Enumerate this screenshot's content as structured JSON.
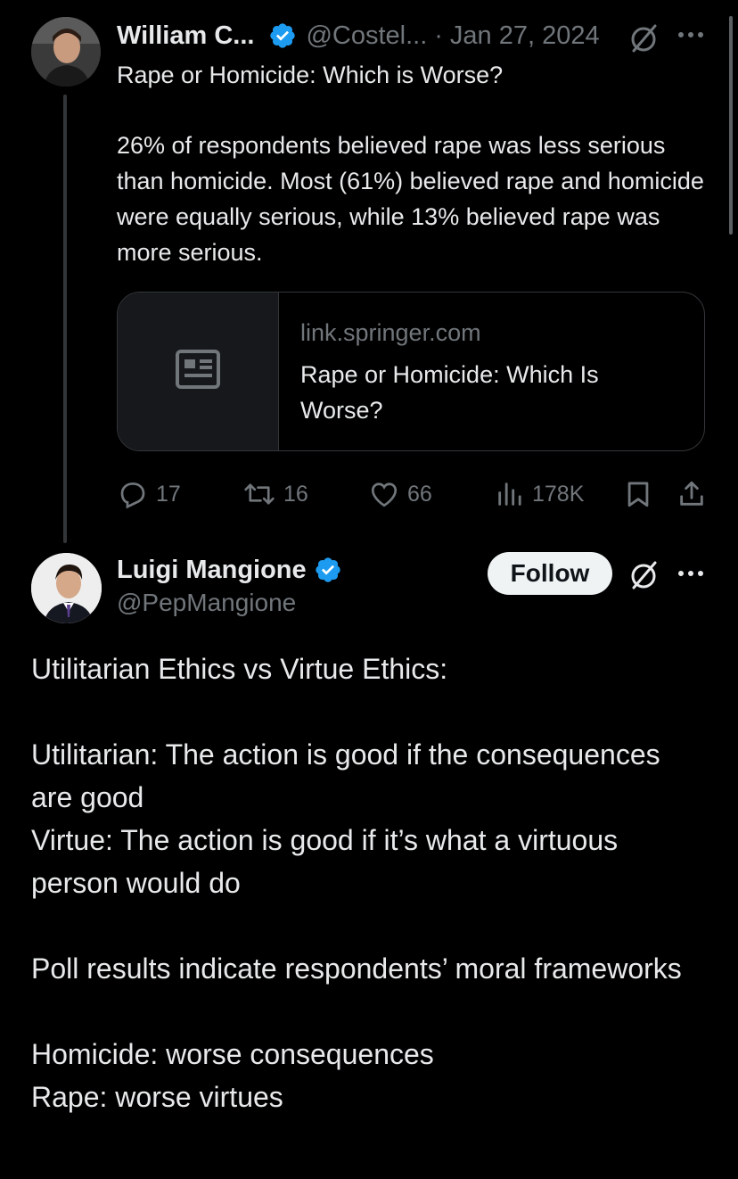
{
  "parent_tweet": {
    "author_name": "William C...",
    "handle": "@Costel...",
    "separator": "·",
    "date": "Jan 27, 2024",
    "title": "Rape or Homicide: Which is Worse?",
    "body": "26% of respondents believed rape was less serious than homicide. Most (61%) believed rape and homicide were equally serious, while 13% believed rape was more serious.",
    "link_card": {
      "domain": "link.springer.com",
      "title": "Rape or Homicide: Which Is Worse?",
      "thumbnail_icon": "article-icon"
    },
    "actions": {
      "replies": "17",
      "reposts": "16",
      "likes": "66",
      "views": "178K"
    }
  },
  "reply_tweet": {
    "author_name": "Luigi Mangione",
    "handle": "@PepMangione",
    "follow_label": "Follow",
    "body_lines": {
      "l1": "Utilitarian Ethics vs Virtue Ethics:",
      "l2": "Utilitarian: The action is good if the consequences are good",
      "l3": "Virtue: The action is good if it’s what a virtuous person would do",
      "l4": "Poll results indicate respondents’ moral frameworks",
      "l5": "Homicide: worse consequences",
      "l6": "Rape: worse virtues"
    }
  },
  "icons": {
    "verified": "verified-badge-icon",
    "grok": "grok-icon",
    "more": "more-icon",
    "reply": "reply-icon",
    "repost": "repost-icon",
    "like": "like-icon",
    "views": "views-icon",
    "bookmark": "bookmark-icon",
    "share": "share-icon"
  },
  "colors": {
    "background": "#000000",
    "text_primary": "#e7e9ea",
    "text_secondary": "#71767b",
    "verified_blue": "#1d9bf0",
    "border": "#333639"
  }
}
